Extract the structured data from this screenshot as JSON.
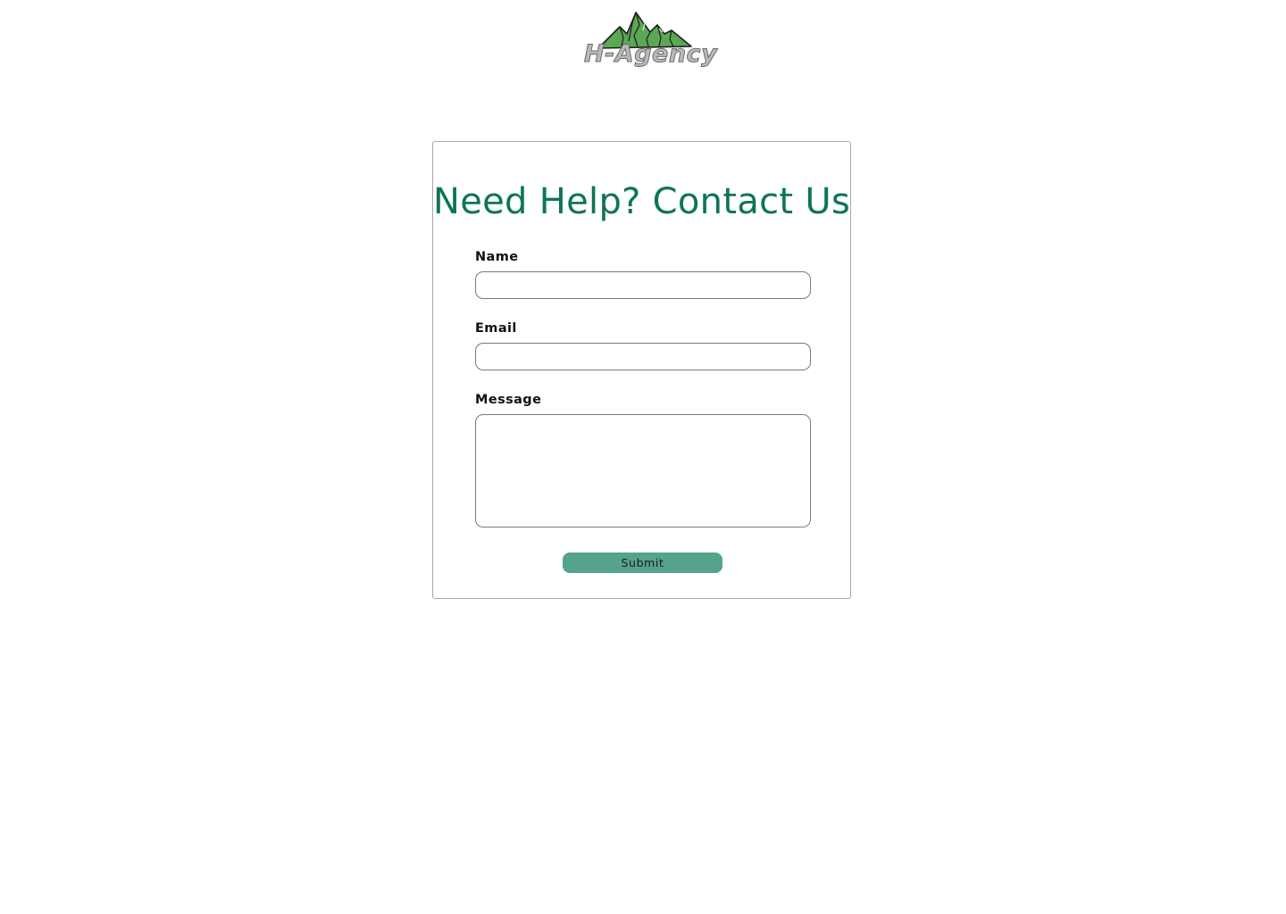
{
  "brand": {
    "logo_text": "H-Agency",
    "logo_icon": "mountain-icon",
    "mountain_color": "#5aa854",
    "text_color": "#b9b9b9"
  },
  "form": {
    "title": "Need Help? Contact Us",
    "title_color": "#0e7458",
    "fields": {
      "name": {
        "label": "Name",
        "value": "",
        "placeholder": ""
      },
      "email": {
        "label": "Email",
        "value": "",
        "placeholder": ""
      },
      "message": {
        "label": "Message",
        "value": "",
        "placeholder": ""
      }
    },
    "submit_label": "Submit",
    "submit_color": "#56a38d"
  }
}
